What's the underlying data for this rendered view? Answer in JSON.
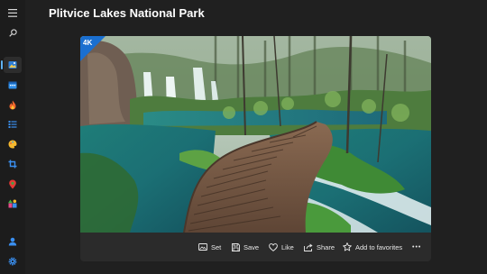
{
  "page": {
    "title": "Plitvice Lakes National Park"
  },
  "photo": {
    "badge": "4K"
  },
  "toolbar": {
    "set": "Set",
    "save": "Save",
    "like": "Like",
    "share": "Share",
    "favorites": "Add to favorites",
    "more": "•••"
  },
  "rail": {
    "icons": [
      "hamburger-icon",
      "search-icon",
      "image-icon",
      "calendar-icon",
      "fire-icon",
      "list-icon",
      "color-icon",
      "crop-icon",
      "location-icon",
      "category-icon",
      "user-icon",
      "settings-icon"
    ],
    "accent": "#5fb2f2"
  }
}
